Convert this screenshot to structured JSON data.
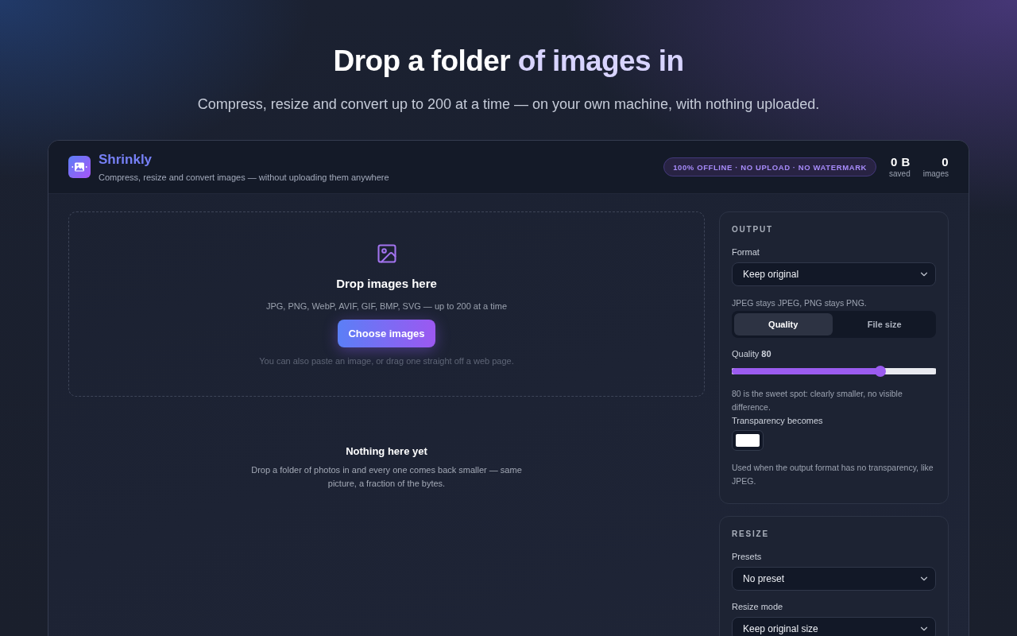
{
  "hero": {
    "title_lead": "Drop a folder",
    "title_accent": "of images in",
    "subtitle": "Compress, resize and convert up to 200 at a time — on your own machine, with nothing uploaded."
  },
  "app_header": {
    "name": "Shrinkly",
    "tagline": "Compress, resize and convert images — without uploading them anywhere",
    "badge": "100% OFFLINE · NO UPLOAD · NO WATERMARK",
    "stats": [
      {
        "value": "0 B",
        "label": "saved"
      },
      {
        "value": "0",
        "label": "images"
      }
    ]
  },
  "drop_zone": {
    "title": "Drop images here",
    "formats": "JPG, PNG, WebP, AVIF, GIF, BMP, SVG — up to 200 at a time",
    "button": "Choose images",
    "note": "You can also paste an image, or drag one straight off a web page."
  },
  "empty_state": {
    "title": "Nothing here yet",
    "description": "Drop a folder of photos in and every one comes back smaller — same picture, a fraction of the bytes."
  },
  "sidebar": {
    "panels": [
      {
        "heading": "OUTPUT",
        "items": [
          {
            "kind": "select",
            "label": "Format",
            "value": "Keep original"
          },
          {
            "kind": "hint",
            "text": "JPEG stays JPEG, PNG stays PNG."
          },
          {
            "kind": "segmented",
            "options": [
              {
                "label": "Quality",
                "selected": true
              },
              {
                "label": "File size",
                "selected": false
              }
            ]
          },
          {
            "kind": "slider",
            "label": "Quality **80**",
            "level": 0.74
          },
          {
            "kind": "hint",
            "text": "80 is the sweet spot: clearly smaller, no visible difference."
          },
          {
            "kind": "color",
            "label": "Transparency becomes",
            "color": "#ffffff"
          },
          {
            "kind": "hint",
            "text": "Used when the output format has no transparency, like JPEG."
          }
        ]
      },
      {
        "heading": "RESIZE",
        "items": [
          {
            "kind": "select",
            "label": "Presets",
            "value": "No preset"
          },
          {
            "kind": "select",
            "label": "Resize mode",
            "value": "Keep original size"
          }
        ]
      }
    ]
  }
}
